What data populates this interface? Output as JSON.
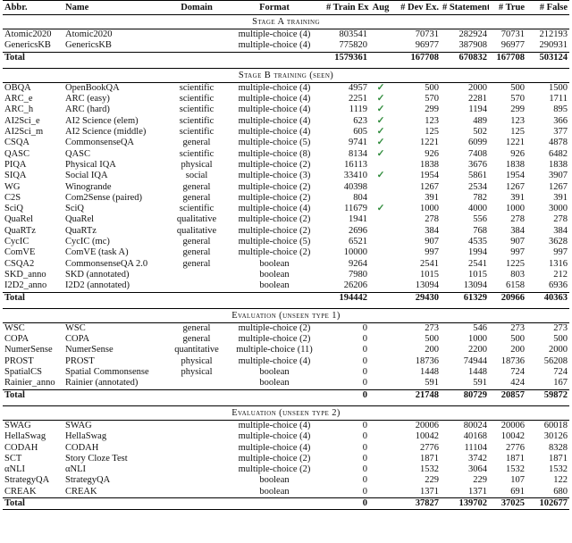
{
  "headers": [
    "Abbr.",
    "Name",
    "Domain",
    "Format",
    "# Train Ex.",
    "Aug",
    "# Dev Ex.",
    "# Statements",
    "# True",
    "# False"
  ],
  "sections": [
    {
      "title": "Stage A training",
      "rows": [
        [
          "Atomic2020",
          "Atomic2020",
          "",
          "multiple-choice (4)",
          "803541",
          "",
          "70731",
          "282924",
          "70731",
          "212193"
        ],
        [
          "GenericsKB",
          "GenericsKB",
          "",
          "multiple-choice (4)",
          "775820",
          "",
          "96977",
          "387908",
          "96977",
          "290931"
        ]
      ],
      "total": [
        "Total",
        "",
        "",
        "",
        "1579361",
        "",
        "167708",
        "670832",
        "167708",
        "503124"
      ]
    },
    {
      "title": "Stage B training (seen)",
      "rows": [
        [
          "OBQA",
          "OpenBookQA",
          "scientific",
          "multiple-choice (4)",
          "4957",
          "✓",
          "500",
          "2000",
          "500",
          "1500"
        ],
        [
          "ARC_e",
          "ARC (easy)",
          "scientific",
          "multiple-choice (4)",
          "2251",
          "✓",
          "570",
          "2281",
          "570",
          "1711"
        ],
        [
          "ARC_h",
          "ARC (hard)",
          "scientific",
          "multiple-choice (4)",
          "1119",
          "✓",
          "299",
          "1194",
          "299",
          "895"
        ],
        [
          "AI2Sci_e",
          "AI2 Science (elem)",
          "scientific",
          "multiple-choice (4)",
          "623",
          "✓",
          "123",
          "489",
          "123",
          "366"
        ],
        [
          "AI2Sci_m",
          "AI2 Science (middle)",
          "scientific",
          "multiple-choice (4)",
          "605",
          "✓",
          "125",
          "502",
          "125",
          "377"
        ],
        [
          "CSQA",
          "CommonsenseQA",
          "general",
          "multiple-choice (5)",
          "9741",
          "✓",
          "1221",
          "6099",
          "1221",
          "4878"
        ],
        [
          "QASC",
          "QASC",
          "scientific",
          "multiple-choice (8)",
          "8134",
          "✓",
          "926",
          "7408",
          "926",
          "6482"
        ],
        [
          "PIQA",
          "Physical IQA",
          "physical",
          "multiple-choice (2)",
          "16113",
          "",
          "1838",
          "3676",
          "1838",
          "1838"
        ],
        [
          "SIQA",
          "Social IQA",
          "social",
          "multiple-choice (3)",
          "33410",
          "✓",
          "1954",
          "5861",
          "1954",
          "3907"
        ],
        [
          "WG",
          "Winogrande",
          "general",
          "multiple-choice (2)",
          "40398",
          "",
          "1267",
          "2534",
          "1267",
          "1267"
        ],
        [
          "C2S",
          "Com2Sense (paired)",
          "general",
          "multiple-choice (2)",
          "804",
          "",
          "391",
          "782",
          "391",
          "391"
        ],
        [
          "SciQ",
          "SciQ",
          "scientific",
          "multiple-choice (4)",
          "11679",
          "✓",
          "1000",
          "4000",
          "1000",
          "3000"
        ],
        [
          "QuaRel",
          "QuaRel",
          "qualitative",
          "multiple-choice (2)",
          "1941",
          "",
          "278",
          "556",
          "278",
          "278"
        ],
        [
          "QuaRTz",
          "QuaRTz",
          "qualitative",
          "multiple-choice (2)",
          "2696",
          "",
          "384",
          "768",
          "384",
          "384"
        ],
        [
          "CycIC",
          "CycIC (mc)",
          "general",
          "multiple-choice (5)",
          "6521",
          "",
          "907",
          "4535",
          "907",
          "3628"
        ],
        [
          "ComVE",
          "ComVE (task A)",
          "general",
          "multiple-choice (2)",
          "10000",
          "",
          "997",
          "1994",
          "997",
          "997"
        ],
        [
          "CSQA2",
          "CommonsenseQA 2.0",
          "general",
          "boolean",
          "9264",
          "",
          "2541",
          "2541",
          "1225",
          "1316"
        ],
        [
          "SKD_anno",
          "SKD (annotated)",
          "",
          "boolean",
          "7980",
          "",
          "1015",
          "1015",
          "803",
          "212"
        ],
        [
          "I2D2_anno",
          "I2D2 (annotated)",
          "",
          "boolean",
          "26206",
          "",
          "13094",
          "13094",
          "6158",
          "6936"
        ]
      ],
      "total": [
        "Total",
        "",
        "",
        "",
        "194442",
        "",
        "29430",
        "61329",
        "20966",
        "40363"
      ]
    },
    {
      "title": "Evaluation (unseen type 1)",
      "rows": [
        [
          "WSC",
          "WSC",
          "general",
          "multiple-choice (2)",
          "0",
          "",
          "273",
          "546",
          "273",
          "273"
        ],
        [
          "COPA",
          "COPA",
          "general",
          "multiple-choice (2)",
          "0",
          "",
          "500",
          "1000",
          "500",
          "500"
        ],
        [
          "NumerSense",
          "NumerSense",
          "quantitative",
          "multiple-choice (11)",
          "0",
          "",
          "200",
          "2200",
          "200",
          "2000"
        ],
        [
          "PROST",
          "PROST",
          "physical",
          "multiple-choice (4)",
          "0",
          "",
          "18736",
          "74944",
          "18736",
          "56208"
        ],
        [
          "SpatialCS",
          "Spatial Commonsense",
          "physical",
          "boolean",
          "0",
          "",
          "1448",
          "1448",
          "724",
          "724"
        ],
        [
          "Rainier_anno",
          "Rainier (annotated)",
          "",
          "boolean",
          "0",
          "",
          "591",
          "591",
          "424",
          "167"
        ]
      ],
      "total": [
        "Total",
        "",
        "",
        "",
        "0",
        "",
        "21748",
        "80729",
        "20857",
        "59872"
      ]
    },
    {
      "title": "Evaluation (unseen type 2)",
      "rows": [
        [
          "SWAG",
          "SWAG",
          "",
          "multiple-choice (4)",
          "0",
          "",
          "20006",
          "80024",
          "20006",
          "60018"
        ],
        [
          "HellaSwag",
          "HellaSwag",
          "",
          "multiple-choice (4)",
          "0",
          "",
          "10042",
          "40168",
          "10042",
          "30126"
        ],
        [
          "CODAH",
          "CODAH",
          "",
          "multiple-choice (4)",
          "0",
          "",
          "2776",
          "11104",
          "2776",
          "8328"
        ],
        [
          "SCT",
          "Story Cloze Test",
          "",
          "multiple-choice (2)",
          "0",
          "",
          "1871",
          "3742",
          "1871",
          "1871"
        ],
        [
          "αNLI",
          "αNLI",
          "",
          "multiple-choice (2)",
          "0",
          "",
          "1532",
          "3064",
          "1532",
          "1532"
        ],
        [
          "StrategyQA",
          "StrategyQA",
          "",
          "boolean",
          "0",
          "",
          "229",
          "229",
          "107",
          "122"
        ],
        [
          "CREAK",
          "CREAK",
          "",
          "boolean",
          "0",
          "",
          "1371",
          "1371",
          "691",
          "680"
        ]
      ],
      "total": [
        "Total",
        "",
        "",
        "",
        "0",
        "",
        "37827",
        "139702",
        "37025",
        "102677"
      ]
    }
  ]
}
